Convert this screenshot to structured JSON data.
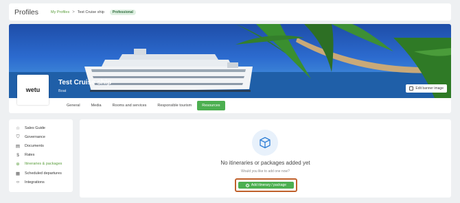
{
  "header": {
    "title": "Profiles",
    "breadcrumb": {
      "parent": "My Profiles",
      "separator": ">",
      "current": "Test Cruise ship"
    },
    "badge": "Professional"
  },
  "profile": {
    "name": "Test Cruise ship",
    "subtitle": "Boat",
    "logo_text": "wetu",
    "edit_banner_label": "Edit banner image"
  },
  "tabs": [
    {
      "label": "General",
      "active": false
    },
    {
      "label": "Media",
      "active": false
    },
    {
      "label": "Rooms and services",
      "active": false
    },
    {
      "label": "Responsible tourism",
      "active": false
    },
    {
      "label": "Resources",
      "active": true
    }
  ],
  "sidebar": {
    "items": [
      {
        "label": "Sales Guide",
        "icon": "star-icon",
        "active": false
      },
      {
        "label": "Governance",
        "icon": "shield-icon",
        "active": false
      },
      {
        "label": "Documents",
        "icon": "document-icon",
        "active": false
      },
      {
        "label": "Rates",
        "icon": "dollar-icon",
        "active": false
      },
      {
        "label": "Itineraries & packages",
        "icon": "compass-icon",
        "active": true
      },
      {
        "label": "Scheduled departures",
        "icon": "calendar-icon",
        "active": false
      },
      {
        "label": "Integrations",
        "icon": "code-icon",
        "active": false
      }
    ]
  },
  "main": {
    "empty_title": "No itineraries or packages added yet",
    "empty_subtitle": "Would you like to add one now?",
    "add_button_label": "Add itinerary / package"
  },
  "colors": {
    "accent_green": "#4caf50",
    "highlight_outline": "#c0602b",
    "link_green": "#5a9e3c"
  }
}
